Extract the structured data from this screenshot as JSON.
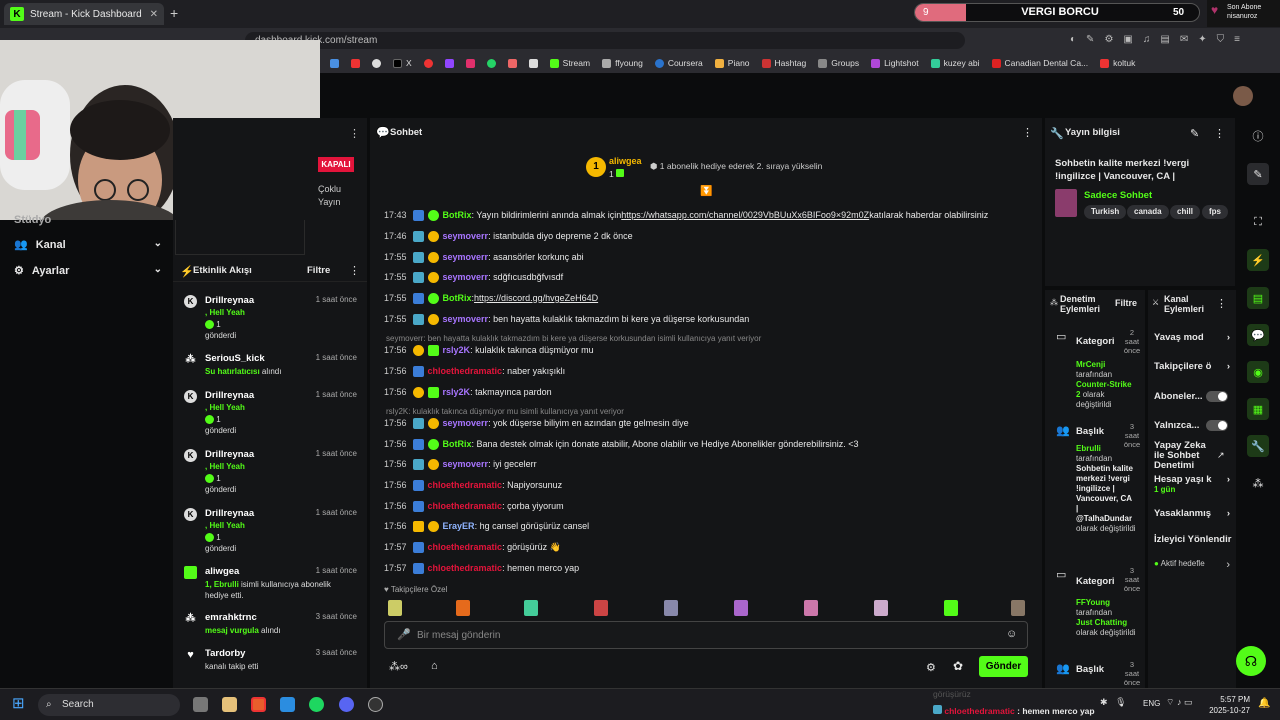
{
  "browser": {
    "tab_title": "Stream - Kick Dashboard",
    "url": "dashboard.kick.com/stream",
    "bookmarks": [
      "X",
      "Stream",
      "ffyoung",
      "Coursera",
      "Piano",
      "Hashtag",
      "Groups",
      "Lightshot",
      "kuzey abi",
      "Canadian Dental Ca...",
      "koltuk"
    ]
  },
  "overlay": {
    "counter": "9",
    "title": "VERGI BORCU",
    "target": "50",
    "progress_fraction": 0.18,
    "last_sub_label": "Son Abone",
    "last_sub_name": "nisanuroz"
  },
  "left_nav": {
    "partial_item": "Stüdyo",
    "kanal": "Kanal",
    "ayarlar": "Ayarlar"
  },
  "stream_card": {
    "status": "KAPALI",
    "line1": "Çoklu",
    "line2": "Yayın"
  },
  "event_feed": {
    "title": "Etkinlik Akışı",
    "filter": "Filtre",
    "events": [
      {
        "name": "Drillreynaa",
        "time": "1 saat önce",
        "line1": ", Hell Yeah",
        "count": "1",
        "line2": "gönderdi"
      },
      {
        "name": "SeriouS_kick",
        "time": "1 saat önce",
        "line1": "Su hatırlatıcısı",
        "line1b": " alındı"
      },
      {
        "name": "Drillreynaa",
        "time": "1 saat önce",
        "line1": ", Hell Yeah",
        "count": "1",
        "line2": "gönderdi"
      },
      {
        "name": "Drillreynaa",
        "time": "1 saat önce",
        "line1": ", Hell Yeah",
        "count": "1",
        "line2": "gönderdi"
      },
      {
        "name": "Drillreynaa",
        "time": "1 saat önce",
        "line1": ", Hell Yeah",
        "count": "1",
        "line2": "gönderdi"
      },
      {
        "name": "aliwgea",
        "time": "1 saat önce",
        "line1": "1, Ebrulli",
        "line1b": " isimli kullanıcıya abonelik",
        "line2": "hediye etti."
      },
      {
        "name": "emrahktrnc",
        "time": "3 saat önce",
        "line1": "mesaj vurgula",
        "line1b": " alındı"
      },
      {
        "name": "Tardorby",
        "time": "3 saat önce",
        "line1": "kanalı takip etti"
      }
    ]
  },
  "chat": {
    "title": "Sohbet",
    "pinned_user": "aliwgea",
    "pinned_rank": "1",
    "pinned_count": "1",
    "pinned_text": "1 abonelik hediye ederek 2. sıraya yükselin",
    "messages": [
      {
        "time": "17:43",
        "user": "BotRix",
        "text": ": Yayın bildirimlerini anında almak için ",
        "link": "https://whatsapp.com/channel/0029VbBUuXx6BIFoo9×92m0Z",
        "after": " katılarak haberdar olabilirsiniz"
      },
      {
        "time": "17:46",
        "user": "seymoverr",
        "text": ": istanbulda diyo depreme 2 dk önce"
      },
      {
        "time": "17:55",
        "user": "seymoverr",
        "text": ": asansörler korkunç abi"
      },
      {
        "time": "17:55",
        "user": "seymoverr",
        "text": ": sdğfıcusdbğfvısdf"
      },
      {
        "time": "17:55",
        "user": "BotRix",
        "text": ": ",
        "link": "https://discord.gg/hvgeZeH64D"
      },
      {
        "time": "17:55",
        "user": "seymoverr",
        "text": ": ben hayatta kulaklık takmazdım bi kere ya düşerse korkusundan"
      },
      {
        "reply": "seymoverr: ben hayatta kulaklık takmazdım bi kere ya düşerse korkusundan isimli kullanıcıya yanıt veriyor"
      },
      {
        "time": "17:56",
        "user": "rsly2K",
        "text": ": kulaklık takınca düşmüyor mu"
      },
      {
        "time": "17:56",
        "user": "chloethedramatic",
        "text": ": naber yakışıklı"
      },
      {
        "time": "17:56",
        "user": "rsly2K",
        "text": ": takmayınca pardon"
      },
      {
        "reply": "rsly2K: kulaklık takınca düşmüyor mu isimli kullanıcıya yanıt veriyor"
      },
      {
        "time": "17:56",
        "user": "seymoverr",
        "text": ": yok düşerse biliyim en azından gte gelmesin diye"
      },
      {
        "time": "17:56",
        "user": "BotRix",
        "text": ": Bana destek olmak için donate atabilir, Abone olabilir ve Hediye Abonelikler gönderebilirsiniz. <3"
      },
      {
        "time": "17:56",
        "user": "seymoverr",
        "text": ": iyi gecelerr"
      },
      {
        "time": "17:56",
        "user": "chloethedramatic",
        "text": ": Napiyorsunuz"
      },
      {
        "time": "17:56",
        "user": "chloethedramatic",
        "text": ": çorba yiyorum"
      },
      {
        "time": "17:56",
        "user": "ErayER",
        "text": ": hg cansel görüşürüz cansel"
      },
      {
        "time": "17:57",
        "user": "chloethedramatic",
        "text": ": görüşürüz 👋"
      },
      {
        "time": "17:57",
        "user": "chloethedramatic",
        "text": ": hemen merco yap"
      }
    ],
    "followers_only": "Takipçilere Özel",
    "input_placeholder": "Bir mesaj gönderin",
    "send": "Gönder"
  },
  "stream_info": {
    "title": "Yayın bilgisi",
    "stream_title": "Sohbetin kalite merkezi !vergi !ingilizce | Vancouver, CA |",
    "category": "Sadece Sohbet",
    "tags": [
      "Turkish",
      "canada",
      "chill",
      "fps"
    ]
  },
  "mod_actions": {
    "title": "Denetim Eylemleri",
    "filter": "Filtre",
    "items": [
      {
        "title": "Kategori",
        "time": "2 saat önce",
        "user": "MrCenji",
        "by": "tarafından",
        "value": "Counter-Strike 2",
        "suffix": "olarak değiştirildi"
      },
      {
        "title": "Başlık",
        "time": "3 saat önce",
        "user": "Ebrulli",
        "by": "tarafından",
        "value": "Sohbetin kalite merkezi !vergi !ingilizce | Vancouver, CA | @TalhaDundar",
        "suffix": "olarak değiştirildi"
      },
      {
        "title": "Kategori",
        "time": "3 saat önce",
        "user": "FFYoung",
        "by": "tarafından",
        "value": "Just Chatting",
        "suffix": "olarak değiştirildi"
      },
      {
        "title": "Başlık",
        "time": "3 saat önce"
      }
    ]
  },
  "channel_actions": {
    "title": "Kanal Eylemleri",
    "items": [
      {
        "label": "Yavaş mod",
        "kind": "chevron"
      },
      {
        "label": "Takipçilere ö",
        "kind": "chevron"
      },
      {
        "label": "Aboneler...",
        "kind": "toggle"
      },
      {
        "label": "Yalnızca...",
        "kind": "toggle"
      },
      {
        "label": "Yapay Zeka ile Sohbet Denetimi",
        "kind": "external"
      },
      {
        "label": "Hesap yaşı k",
        "sub": "1 gün",
        "kind": "chevron"
      },
      {
        "label": "Yasaklanmış",
        "kind": "chevron"
      },
      {
        "label": "İzleyici Yönlendir",
        "kind": "none"
      },
      {
        "label": "Aktif hedefle",
        "kind": "chevron"
      }
    ]
  },
  "taskbar": {
    "search": "Search",
    "lang": "ENG",
    "time": "5:57 PM",
    "date": "2025-10-27",
    "toast_faded": "görüşürüz",
    "toast_user": "chloethedramatic",
    "toast_text": " : hemen merco yap"
  },
  "colors": {
    "accent": "#53fc18",
    "bot": "#53fc18",
    "seymoverr": "#a875ff",
    "chloe": "#e3143b",
    "rsly": "#a875ff",
    "eray": "#8fb4ff"
  }
}
